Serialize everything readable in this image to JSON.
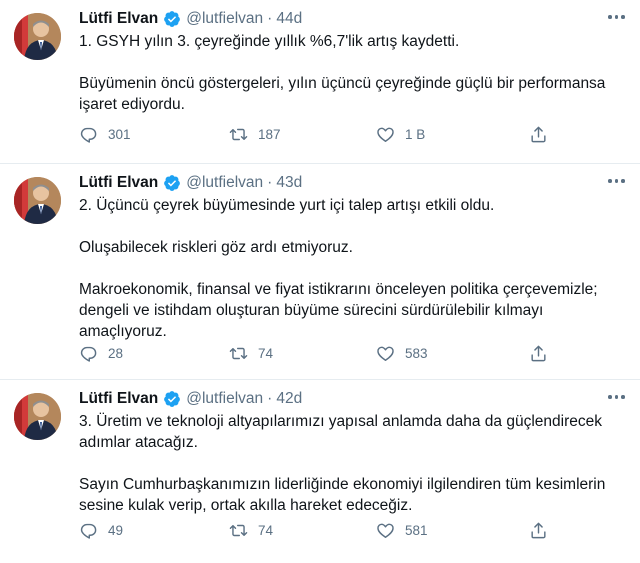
{
  "tweets": [
    {
      "name": "Lütfi Elvan",
      "handle": "@lutfielvan",
      "separator": "·",
      "time": "44d",
      "paragraphs": [
        "1. GSYH yılın 3. çeyreğinde yıllık %6,7'lik artış kaydetti.",
        "Büyümenin öncü göstergeleri, yılın üçüncü çeyreğinde güçlü bir performansa işaret ediyordu."
      ],
      "replies": "301",
      "retweets": "187",
      "likes": "1 B"
    },
    {
      "name": "Lütfi Elvan",
      "handle": "@lutfielvan",
      "separator": "·",
      "time": "43d",
      "paragraphs": [
        "2. Üçüncü çeyrek büyümesinde yurt içi talep artışı etkili oldu.",
        "Oluşabilecek riskleri göz ardı etmiyoruz.",
        "Makroekonomik, finansal ve fiyat istikrarını önceleyen politika çerçevemizle; dengeli ve istihdam oluşturan büyüme sürecini sürdürülebilir kılmayı amaçlıyoruz."
      ],
      "replies": "28",
      "retweets": "74",
      "likes": "583"
    },
    {
      "name": "Lütfi Elvan",
      "handle": "@lutfielvan",
      "separator": "·",
      "time": "42d",
      "paragraphs": [
        "3. Üretim ve teknoloji altyapılarımızı yapısal anlamda daha da güçlendirecek adımlar atacağız.",
        "Sayın Cumhurbaşkanımızın liderliğinde ekonomiyi ilgilendiren tüm kesimlerin sesine kulak verip, ortak akılla hareket edeceğiz."
      ],
      "replies": "49",
      "retweets": "74",
      "likes": "581"
    }
  ],
  "icons": {
    "verified": "verified-badge-icon",
    "more": "more-options-icon",
    "reply": "reply-icon",
    "retweet": "retweet-icon",
    "like": "heart-icon",
    "share": "share-icon"
  },
  "colors": {
    "text": "#0f1419",
    "secondary": "#5b7083",
    "verified": "#1da1f2",
    "divider": "#e6ecf0"
  }
}
